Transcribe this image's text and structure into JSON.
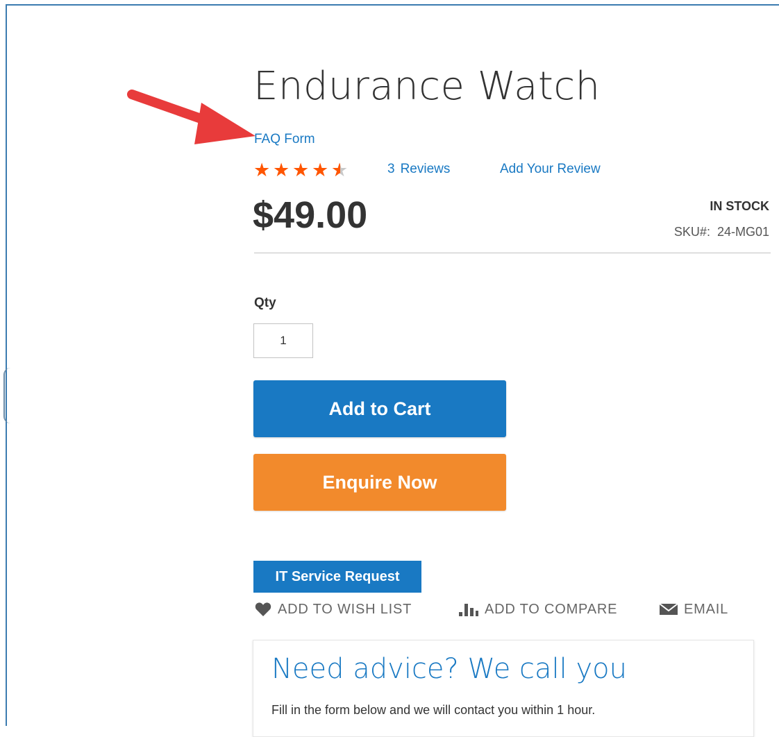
{
  "product": {
    "title": "Endurance Watch",
    "faq_link": "FAQ Form",
    "rating": {
      "value": 4.5,
      "max": 5
    },
    "review_count": "3",
    "reviews_label": "Reviews",
    "add_review_label": "Add Your Review",
    "price": "$49.00",
    "stock_status": "IN STOCK",
    "sku_label": "SKU#:",
    "sku_value": "24-MG01"
  },
  "purchase": {
    "qty_label": "Qty",
    "qty_value": "1",
    "add_to_cart_label": "Add to Cart",
    "enquire_label": "Enquire Now",
    "it_service_label": "IT Service Request"
  },
  "actions": {
    "wishlist_label": "ADD TO WISH LIST",
    "compare_label": "ADD TO COMPARE",
    "email_label": "EMAIL"
  },
  "advice": {
    "title": "Need advice? We call you",
    "text": "Fill in the form below and we will contact you within 1 hour."
  },
  "colors": {
    "link": "#1979c3",
    "primary_button": "#1979c3",
    "enquire_button": "#f28a2c",
    "star": "#ff5501",
    "annotation_arrow": "#e83b3b"
  },
  "icons": {
    "annotation": "arrow-icon",
    "wishlist": "heart-icon",
    "compare": "bar-chart-icon",
    "email": "envelope-icon",
    "rating": "star-icon"
  }
}
